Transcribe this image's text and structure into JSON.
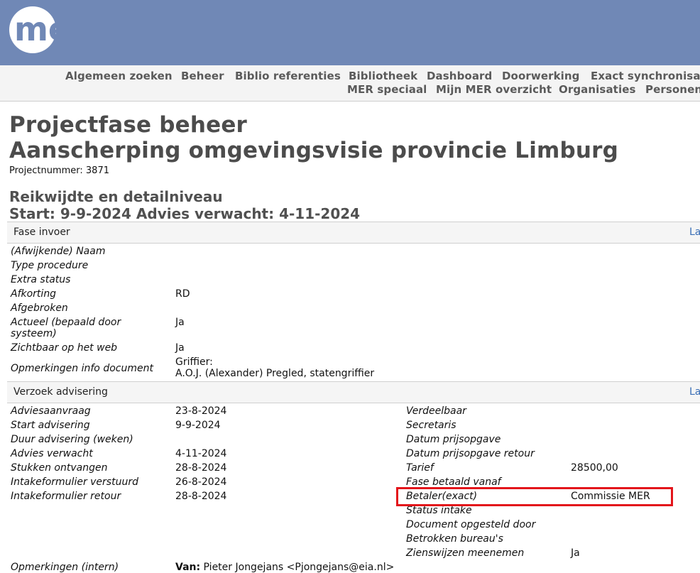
{
  "logo": {
    "text": "mer"
  },
  "nav": {
    "row1": [
      "Algemeen zoeken",
      "Beheer",
      "Biblio referenties",
      "Bibliotheek",
      "Dashboard",
      "Doorwerking",
      "Exact synchronisat"
    ],
    "row2": [
      "MER speciaal",
      "Mijn MER overzicht",
      "Organisaties",
      "Personen"
    ]
  },
  "page": {
    "title1": "Projectfase beheer",
    "title2": "Aanscherping omgevingsvisie provincie Limburg",
    "project_number": "Projectnummer: 3871",
    "phase_title": "Reikwijdte en detailniveau",
    "phase_dates": "Start: 9-9-2024 Advies verwacht: 4-11-2024"
  },
  "fase_invoer": {
    "header": "Fase invoer",
    "link": "La",
    "rows": [
      {
        "label": "(Afwijkende) Naam",
        "value": ""
      },
      {
        "label": "Type procedure",
        "value": ""
      },
      {
        "label": "Extra status",
        "value": ""
      },
      {
        "label": "Afkorting",
        "value": "RD"
      },
      {
        "label": "Afgebroken",
        "value": ""
      },
      {
        "label": "Actueel (bepaald door",
        "label2": "systeem)",
        "value": "Ja"
      },
      {
        "label": "Zichtbaar op het web",
        "value": "Ja"
      },
      {
        "label": "Opmerkingen info document",
        "value": "Griffier:",
        "value2": "A.O.J. (Alexander) Pregled, statengriffier"
      }
    ]
  },
  "verzoek": {
    "header": "Verzoek advisering",
    "link": "La",
    "left": [
      {
        "label": "Adviesaanvraag",
        "value": "23-8-2024"
      },
      {
        "label": "Start advisering",
        "value": "9-9-2024"
      },
      {
        "label": "Duur advisering (weken)",
        "value": ""
      },
      {
        "label": "Advies verwacht",
        "value": "4-11-2024"
      },
      {
        "label": "Stukken ontvangen",
        "value": "28-8-2024"
      },
      {
        "label": "Intakeformulier verstuurd",
        "value": "26-8-2024"
      },
      {
        "label": "Intakeformulier retour",
        "value": "28-8-2024"
      }
    ],
    "right": [
      {
        "label": "Verdeelbaar",
        "value": ""
      },
      {
        "label": "Secretaris",
        "value": ""
      },
      {
        "label": "Datum prijsopgave",
        "value": ""
      },
      {
        "label": "Datum prijsopgave retour",
        "value": ""
      },
      {
        "label": "Tarief",
        "value": "28500,00"
      },
      {
        "label": "Fase betaald vanaf",
        "value": ""
      },
      {
        "label": "Betaler(exact)",
        "value": "Commissie MER"
      },
      {
        "label": "Status intake",
        "value": ""
      },
      {
        "label": "Document opgesteld door",
        "value": ""
      },
      {
        "label": "Betrokken bureau's",
        "value": ""
      },
      {
        "label": "Zienswijzen meenemen",
        "value": "Ja"
      }
    ],
    "bottom_label": "Opmerkingen (intern)",
    "bottom_value_bold": "Van:",
    "bottom_value": "Pieter Jongejans <Pjongejans@eia.nl>"
  },
  "colors": {
    "header_bg": "#7088b6",
    "highlight": "#e3151b",
    "link": "#3b6fb6"
  }
}
